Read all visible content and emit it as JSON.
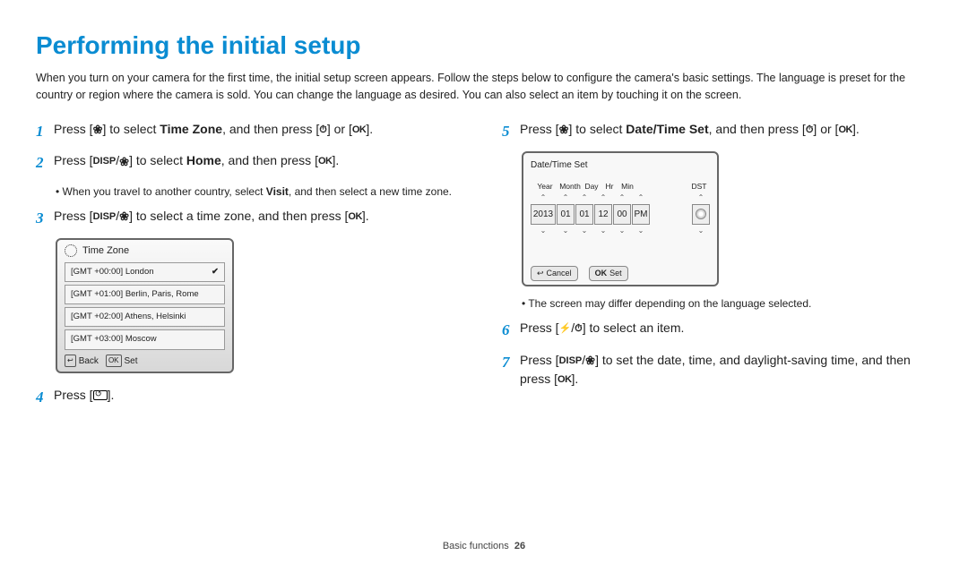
{
  "title": "Performing the initial setup",
  "intro": "When you turn on your camera for the first time, the initial setup screen appears. Follow the steps below to configure the camera's basic settings. The language is preset for the country or region where the camera is sold. You can change the language as desired. You can also select an item by touching it on the screen.",
  "steps": {
    "s1a": "Press [",
    "s1b": "] to select ",
    "s1c": "Time Zone",
    "s1d": ", and then press [",
    "s1e": "] or [",
    "s1f": "].",
    "s2a": "Press [",
    "s2b": "] to select ",
    "s2c": "Home",
    "s2d": ", and then press [",
    "s2e": "].",
    "s2bullet_a": "When you travel to another country, select ",
    "s2bullet_b": "Visit",
    "s2bullet_c": ", and then select a new time zone.",
    "s3a": "Press [",
    "s3b": "] to select a time zone, and then press [",
    "s3c": "].",
    "s4a": "Press [",
    "s4b": "].",
    "s5a": "Press [",
    "s5b": "] to select ",
    "s5c": "Date/Time Set",
    "s5d": ", and then press [",
    "s5e": "] or [",
    "s5f": "].",
    "s5bullet": "The screen may differ depending on the language selected.",
    "s6a": "Press [",
    "s6b": "] to select an item.",
    "s7a": "Press [",
    "s7b": "] to set the date, time, and daylight-saving time, and then press [",
    "s7c": "]."
  },
  "icons": {
    "macro": "❀",
    "timer": "⏱",
    "ok": "OK",
    "disp": "DISP",
    "flash": "⚡"
  },
  "tz_screen": {
    "title": "Time Zone",
    "items": [
      "[GMT +00:00] London",
      "[GMT +01:00] Berlin, Paris, Rome",
      "[GMT +02:00] Athens, Helsinki",
      "[GMT +03:00] Moscow"
    ],
    "back": "Back",
    "set": "Set"
  },
  "dt_screen": {
    "title": "Date/Time Set",
    "labels": [
      "Year",
      "Month",
      "Day",
      "Hr",
      "Min",
      "DST"
    ],
    "values": [
      "2013",
      "01",
      "01",
      "12",
      "00",
      "PM"
    ],
    "cancel": "Cancel",
    "set": "Set"
  },
  "footer": {
    "section": "Basic functions",
    "page": "26"
  }
}
